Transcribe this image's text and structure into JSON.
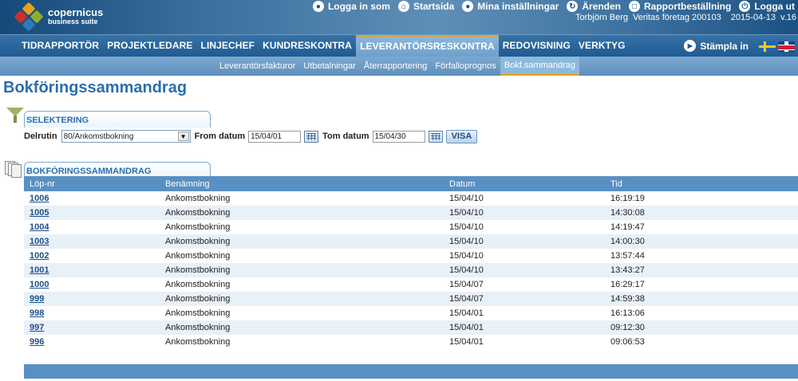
{
  "brand": {
    "name": "copernicus",
    "subtitle": "business suite"
  },
  "top_links": [
    {
      "icon": "user-icon",
      "label": "Logga in som"
    },
    {
      "icon": "home-icon",
      "label": "Startsida"
    },
    {
      "icon": "person-icon",
      "label": "Mina inställningar"
    },
    {
      "icon": "refresh-icon",
      "label": "Ärenden"
    },
    {
      "icon": "document-icon",
      "label": "Rapportbeställning"
    },
    {
      "icon": "power-icon",
      "label": "Logga ut"
    }
  ],
  "user_info": {
    "name": "Torbjörn Berg",
    "company": "Veritas företag 200103",
    "date": "2015-04-13",
    "version": "v.16"
  },
  "main_nav": [
    "TIDRAPPORTÖR",
    "PROJEKTLEDARE",
    "LINJECHEF",
    "KUNDRESKONTRA",
    "LEVERANTÖRSRESKONTRA",
    "REDOVISNING",
    "VERKTYG"
  ],
  "main_nav_active": "LEVERANTÖRSRESKONTRA",
  "stampla_label": "Stämpla in",
  "sub_nav": [
    "Leverantörsfakturor",
    "Utbetalningar",
    "Återrapportering",
    "Förfalloprognos",
    "Bokf.sammandrag"
  ],
  "sub_nav_active": "Bokf.sammandrag",
  "page_title": "Bokföringssammandrag",
  "selection": {
    "tab_title": "SELEKTERING",
    "delrutin_label": "Delrutin",
    "delrutin_value": "80/Ankomstbokning",
    "from_label": "From datum",
    "from_value": "15/04/01",
    "tom_label": "Tom datum",
    "tom_value": "15/04/30",
    "visa_label": "VISA"
  },
  "summary": {
    "tab_title": "BOKFÖRINGSSAMMANDRAG",
    "columns": [
      "Löp-nr",
      "Benämning",
      "Datum",
      "Tid"
    ],
    "rows": [
      [
        "1006",
        "Ankomstbokning",
        "15/04/10",
        "16:19:19"
      ],
      [
        "1005",
        "Ankomstbokning",
        "15/04/10",
        "14:30:08"
      ],
      [
        "1004",
        "Ankomstbokning",
        "15/04/10",
        "14:19:47"
      ],
      [
        "1003",
        "Ankomstbokning",
        "15/04/10",
        "14:00:30"
      ],
      [
        "1002",
        "Ankomstbokning",
        "15/04/10",
        "13:57:44"
      ],
      [
        "1001",
        "Ankomstbokning",
        "15/04/10",
        "13:43:27"
      ],
      [
        "1000",
        "Ankomstbokning",
        "15/04/07",
        "16:29:17"
      ],
      [
        "999",
        "Ankomstbokning",
        "15/04/07",
        "14:59:38"
      ],
      [
        "998",
        "Ankomstbokning",
        "15/04/01",
        "16:13:06"
      ],
      [
        "997",
        "Ankomstbokning",
        "15/04/01",
        "09:12:30"
      ],
      [
        "996",
        "Ankomstbokning",
        "15/04/01",
        "09:06:53"
      ]
    ]
  },
  "colors": {
    "header": "#3a6f9e",
    "accent": "#f0a20f",
    "title": "#2a6eac",
    "table_header": "#5990c3"
  }
}
